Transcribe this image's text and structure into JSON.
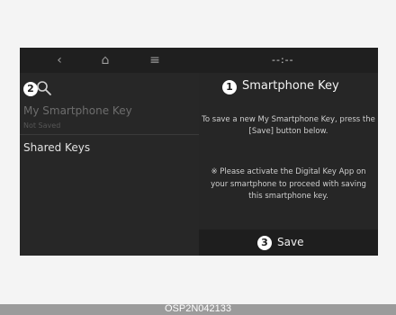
{
  "nav": {
    "back_glyph": "‹",
    "home_glyph": "⌂",
    "menu_glyph": "≡",
    "clock": "--:--"
  },
  "badges": {
    "one": "1",
    "two": "2",
    "three": "3"
  },
  "list": {
    "items": [
      {
        "label": "My Smartphone Key",
        "status": "Not Saved"
      },
      {
        "label": "Shared Keys"
      }
    ]
  },
  "panel": {
    "title": "Smartphone Key",
    "instruction": "To save a new My Smartphone Key, press the [Save] button below.",
    "note": "※ Please activate the Digital Key App on your smartphone to proceed with saving this smartphone key.",
    "save_label": "Save"
  },
  "caption": "OSP2N042133"
}
